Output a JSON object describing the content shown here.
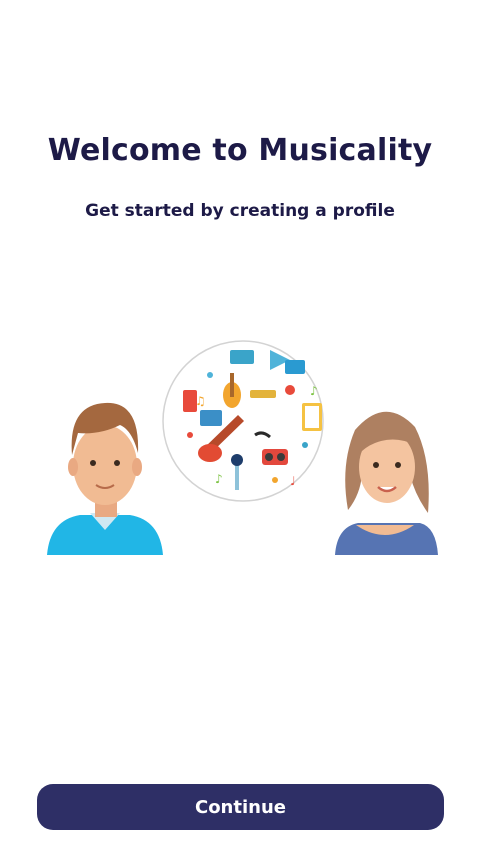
{
  "welcome": {
    "title": "Welcome to Musicality",
    "subtitle": "Get started by creating a profile"
  },
  "illustration": {
    "left_person": "man-avatar-icon",
    "center": "music-instruments-circle-icon",
    "right_person": "woman-avatar-icon"
  },
  "actions": {
    "continue_label": "Continue"
  },
  "colors": {
    "heading": "#1d1a47",
    "button": "#2e2f66",
    "button_text": "#ffffff"
  }
}
